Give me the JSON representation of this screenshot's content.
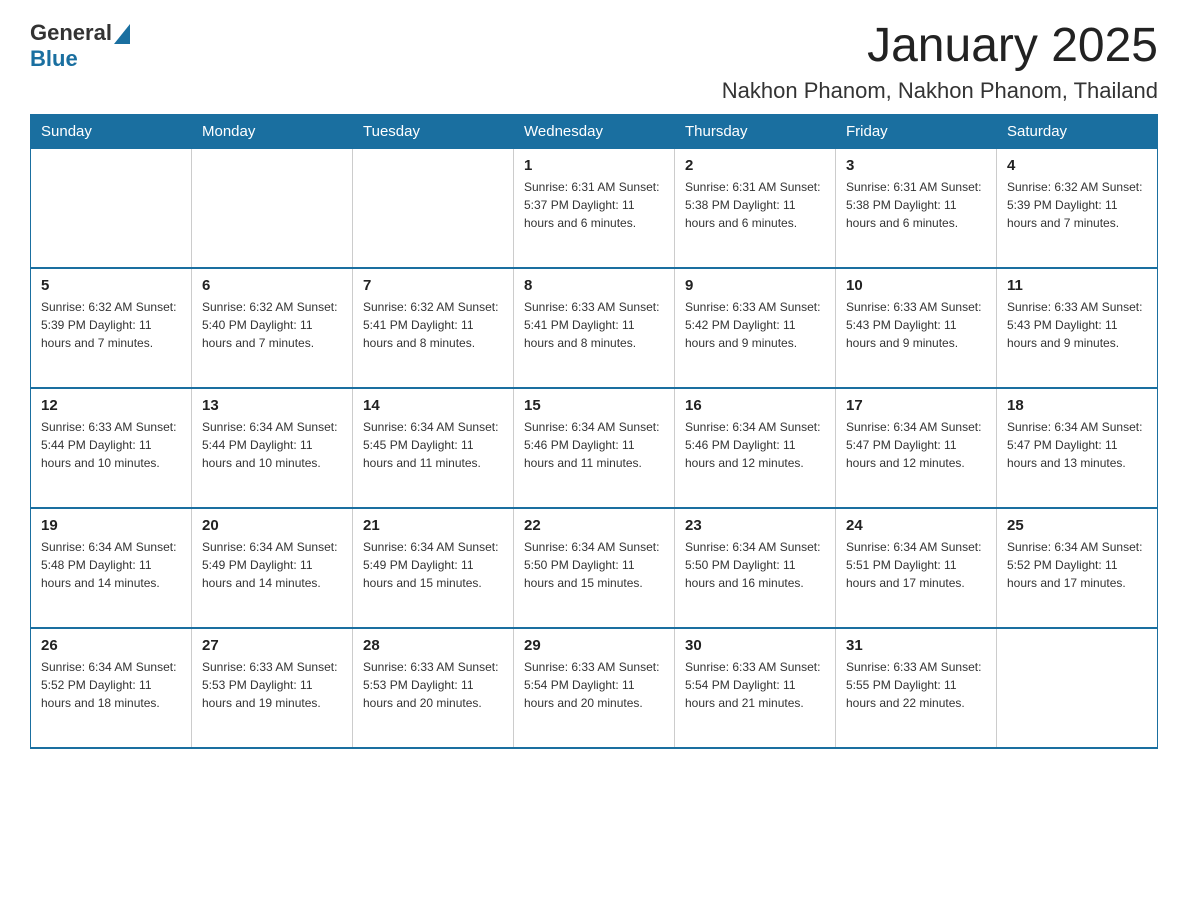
{
  "header": {
    "logo_general": "General",
    "logo_blue": "Blue",
    "month": "January 2025",
    "location": "Nakhon Phanom, Nakhon Phanom, Thailand"
  },
  "days_of_week": [
    "Sunday",
    "Monday",
    "Tuesday",
    "Wednesday",
    "Thursday",
    "Friday",
    "Saturday"
  ],
  "weeks": [
    [
      {
        "day": "",
        "info": ""
      },
      {
        "day": "",
        "info": ""
      },
      {
        "day": "",
        "info": ""
      },
      {
        "day": "1",
        "info": "Sunrise: 6:31 AM\nSunset: 5:37 PM\nDaylight: 11 hours and 6 minutes."
      },
      {
        "day": "2",
        "info": "Sunrise: 6:31 AM\nSunset: 5:38 PM\nDaylight: 11 hours and 6 minutes."
      },
      {
        "day": "3",
        "info": "Sunrise: 6:31 AM\nSunset: 5:38 PM\nDaylight: 11 hours and 6 minutes."
      },
      {
        "day": "4",
        "info": "Sunrise: 6:32 AM\nSunset: 5:39 PM\nDaylight: 11 hours and 7 minutes."
      }
    ],
    [
      {
        "day": "5",
        "info": "Sunrise: 6:32 AM\nSunset: 5:39 PM\nDaylight: 11 hours and 7 minutes."
      },
      {
        "day": "6",
        "info": "Sunrise: 6:32 AM\nSunset: 5:40 PM\nDaylight: 11 hours and 7 minutes."
      },
      {
        "day": "7",
        "info": "Sunrise: 6:32 AM\nSunset: 5:41 PM\nDaylight: 11 hours and 8 minutes."
      },
      {
        "day": "8",
        "info": "Sunrise: 6:33 AM\nSunset: 5:41 PM\nDaylight: 11 hours and 8 minutes."
      },
      {
        "day": "9",
        "info": "Sunrise: 6:33 AM\nSunset: 5:42 PM\nDaylight: 11 hours and 9 minutes."
      },
      {
        "day": "10",
        "info": "Sunrise: 6:33 AM\nSunset: 5:43 PM\nDaylight: 11 hours and 9 minutes."
      },
      {
        "day": "11",
        "info": "Sunrise: 6:33 AM\nSunset: 5:43 PM\nDaylight: 11 hours and 9 minutes."
      }
    ],
    [
      {
        "day": "12",
        "info": "Sunrise: 6:33 AM\nSunset: 5:44 PM\nDaylight: 11 hours and 10 minutes."
      },
      {
        "day": "13",
        "info": "Sunrise: 6:34 AM\nSunset: 5:44 PM\nDaylight: 11 hours and 10 minutes."
      },
      {
        "day": "14",
        "info": "Sunrise: 6:34 AM\nSunset: 5:45 PM\nDaylight: 11 hours and 11 minutes."
      },
      {
        "day": "15",
        "info": "Sunrise: 6:34 AM\nSunset: 5:46 PM\nDaylight: 11 hours and 11 minutes."
      },
      {
        "day": "16",
        "info": "Sunrise: 6:34 AM\nSunset: 5:46 PM\nDaylight: 11 hours and 12 minutes."
      },
      {
        "day": "17",
        "info": "Sunrise: 6:34 AM\nSunset: 5:47 PM\nDaylight: 11 hours and 12 minutes."
      },
      {
        "day": "18",
        "info": "Sunrise: 6:34 AM\nSunset: 5:47 PM\nDaylight: 11 hours and 13 minutes."
      }
    ],
    [
      {
        "day": "19",
        "info": "Sunrise: 6:34 AM\nSunset: 5:48 PM\nDaylight: 11 hours and 14 minutes."
      },
      {
        "day": "20",
        "info": "Sunrise: 6:34 AM\nSunset: 5:49 PM\nDaylight: 11 hours and 14 minutes."
      },
      {
        "day": "21",
        "info": "Sunrise: 6:34 AM\nSunset: 5:49 PM\nDaylight: 11 hours and 15 minutes."
      },
      {
        "day": "22",
        "info": "Sunrise: 6:34 AM\nSunset: 5:50 PM\nDaylight: 11 hours and 15 minutes."
      },
      {
        "day": "23",
        "info": "Sunrise: 6:34 AM\nSunset: 5:50 PM\nDaylight: 11 hours and 16 minutes."
      },
      {
        "day": "24",
        "info": "Sunrise: 6:34 AM\nSunset: 5:51 PM\nDaylight: 11 hours and 17 minutes."
      },
      {
        "day": "25",
        "info": "Sunrise: 6:34 AM\nSunset: 5:52 PM\nDaylight: 11 hours and 17 minutes."
      }
    ],
    [
      {
        "day": "26",
        "info": "Sunrise: 6:34 AM\nSunset: 5:52 PM\nDaylight: 11 hours and 18 minutes."
      },
      {
        "day": "27",
        "info": "Sunrise: 6:33 AM\nSunset: 5:53 PM\nDaylight: 11 hours and 19 minutes."
      },
      {
        "day": "28",
        "info": "Sunrise: 6:33 AM\nSunset: 5:53 PM\nDaylight: 11 hours and 20 minutes."
      },
      {
        "day": "29",
        "info": "Sunrise: 6:33 AM\nSunset: 5:54 PM\nDaylight: 11 hours and 20 minutes."
      },
      {
        "day": "30",
        "info": "Sunrise: 6:33 AM\nSunset: 5:54 PM\nDaylight: 11 hours and 21 minutes."
      },
      {
        "day": "31",
        "info": "Sunrise: 6:33 AM\nSunset: 5:55 PM\nDaylight: 11 hours and 22 minutes."
      },
      {
        "day": "",
        "info": ""
      }
    ]
  ]
}
